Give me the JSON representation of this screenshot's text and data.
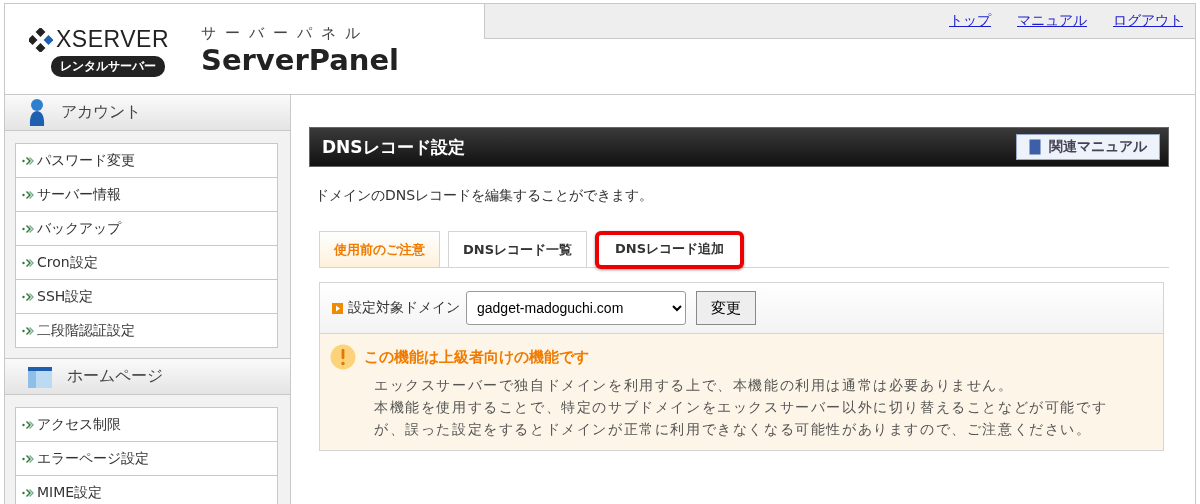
{
  "header": {
    "logo": {
      "brand": "XSERVER",
      "badge": "レンタルサーバー"
    },
    "product": {
      "kana": "サーバーパネル",
      "title": "ServerPanel"
    },
    "nav_links": [
      "トップ",
      "マニュアル",
      "ログアウト"
    ]
  },
  "sidebar": {
    "sections": [
      {
        "title": "アカウント",
        "kind": "account",
        "items": [
          "パスワード変更",
          "サーバー情報",
          "バックアップ",
          "Cron設定",
          "SSH設定",
          "二段階認証設定"
        ]
      },
      {
        "title": "ホームページ",
        "kind": "homepage",
        "items": [
          "アクセス制限",
          "エラーページ設定",
          "MIME設定"
        ]
      }
    ]
  },
  "main": {
    "title": "DNSレコード設定",
    "manual_button": "関連マニュアル",
    "description": "ドメインのDNSレコードを編集することができます。",
    "tabs": [
      {
        "label": "使用前のご注意",
        "selected": true,
        "highlighted": false
      },
      {
        "label": "DNSレコード一覧",
        "selected": false,
        "highlighted": false
      },
      {
        "label": "DNSレコード追加",
        "selected": false,
        "highlighted": true
      }
    ],
    "domain_form": {
      "label": "設定対象ドメイン",
      "value": "gadget-madoguchi.com",
      "button": "変更"
    },
    "notice": {
      "title": "この機能は上級者向けの機能です",
      "paragraphs": [
        "エックスサーバーで独自ドメインを利用する上で、本機能の利用は通常は必要ありません。",
        "本機能を使用することで、特定のサブドメインをエックスサーバー以外に切り替えることなどが可能ですが、誤った設定をするとドメインが正常に利用できなくなる可能性がありますので、ご注意ください。"
      ]
    }
  }
}
